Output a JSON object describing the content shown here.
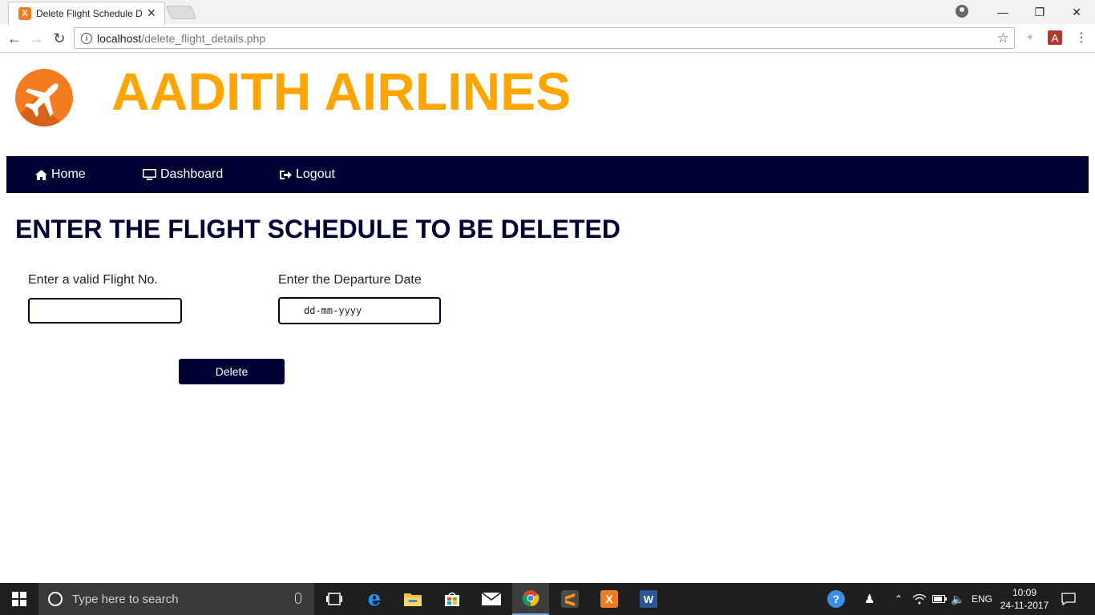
{
  "browser": {
    "tab_title": "Delete Flight Schedule D",
    "tab_favicon_letter": "X",
    "url_host": "localhost",
    "url_path": "/delete_flight_details.php"
  },
  "site": {
    "title": "AADITH AIRLINES"
  },
  "nav": {
    "items": [
      {
        "label": "Home",
        "icon": "home-icon"
      },
      {
        "label": "Dashboard",
        "icon": "monitor-icon"
      },
      {
        "label": "Logout",
        "icon": "logout-icon"
      }
    ]
  },
  "form": {
    "heading": "ENTER THE FLIGHT SCHEDULE TO BE DELETED",
    "flight_label": "Enter a valid Flight No.",
    "flight_value": "",
    "date_label": "Enter the Departure Date",
    "date_placeholder": "dd-mm-yyyy",
    "delete_label": "Delete"
  },
  "taskbar": {
    "search_placeholder": "Type here to search",
    "language": "ENG",
    "time": "10:09",
    "date": "24-11-2017"
  },
  "colors": {
    "brand_orange": "#ffa500",
    "navy": "#000033",
    "logo_orange": "#f47c20"
  }
}
